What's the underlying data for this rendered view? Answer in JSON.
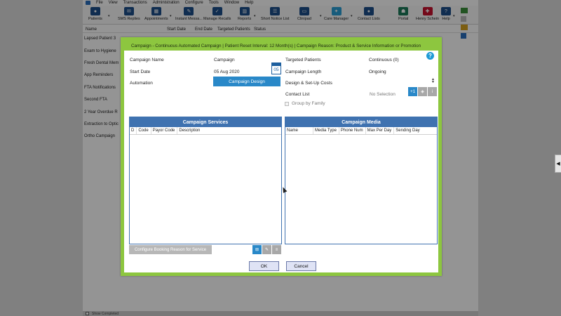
{
  "menu": [
    "File",
    "View",
    "Transactions",
    "Administration",
    "Configure",
    "Tools",
    "Window",
    "Help"
  ],
  "toolbar": [
    {
      "label": "Patients",
      "icon": "patients-icon",
      "color": "#1c4e8a"
    },
    {
      "label": "SMS Replies",
      "icon": "sms-icon",
      "color": "#1c4e8a"
    },
    {
      "label": "Appointments",
      "icon": "appointments-icon",
      "color": "#1c4e8a"
    },
    {
      "label": "Instant Messa...",
      "icon": "instant-message-icon",
      "color": "#1c4e8a"
    },
    {
      "label": "Manage Recalls",
      "icon": "recalls-icon",
      "color": "#1c4e8a"
    },
    {
      "label": "Reports",
      "icon": "reports-icon",
      "color": "#1c4e8a"
    },
    {
      "label": "Short Notice List",
      "icon": "short-notice-icon",
      "color": "#1c4e8a"
    },
    {
      "label": "Clinipad",
      "icon": "clinipad-icon",
      "color": "#1c4e8a"
    },
    {
      "label": "Care Manager",
      "icon": "care-manager-icon",
      "color": "#2a9fd6"
    },
    {
      "label": "Contact Lists",
      "icon": "contact-lists-icon",
      "color": "#1c4e8a"
    },
    {
      "label": "Portal",
      "icon": "portal-icon",
      "color": "#1c7a5a"
    },
    {
      "label": "Henry Schein",
      "icon": "henry-schein-icon",
      "color": "#c8102e"
    },
    {
      "label": "Help",
      "icon": "help-toolbar-icon",
      "color": "#1c4e8a"
    }
  ],
  "list_header": {
    "name": "Name",
    "start_date": "Start Date",
    "end_date": "End Date",
    "targeted": "Targeted Patients",
    "status": "Status"
  },
  "campaigns": [
    "Lapsed Patient 3",
    "Exam to Hygiene",
    "Fresh Dental Mem",
    "App Reminders",
    "FTA Notifications",
    "Second FTA",
    "2 Year Overdue R",
    "Extraction to Optic",
    "Ortho Campaign"
  ],
  "bottom": {
    "show_completed": "Show Completed"
  },
  "modal": {
    "title": "Campaign - Continuous Automated Campaign | Patient Reset Interval: 12 Month(s) | Campaign Reason: Product & Service Information or Promotion",
    "campaign_name_label": "Campaign Name",
    "campaign_name_value": "Campaign",
    "start_date_label": "Start Date",
    "start_date_value": "05 Aug 2020",
    "calendar_day": "05",
    "automation_label": "Automation",
    "campaign_design_button": "Campaign Design",
    "targeted_label": "Targeted Patients",
    "targeted_value": "Continuous (0)",
    "length_label": "Campaign Length",
    "length_value": "Ongoing",
    "costs_label": "Design & Set-Up Costs",
    "contact_list_label": "Contact List",
    "contact_list_value": "No Selection",
    "contact_add_button": "+1",
    "group_by_family": "Group by Family",
    "services": {
      "title": "Campaign Services",
      "columns": [
        "D",
        "Code",
        "Payor Code",
        "Description"
      ]
    },
    "media": {
      "title": "Campaign Media",
      "columns": [
        "Name",
        "Media Type",
        "Phone Num",
        "Max Per Day",
        "Sending Day"
      ]
    },
    "configure_button": "Configure Booking Reason for Service",
    "ok_button": "OK",
    "cancel_button": "Cancel"
  }
}
